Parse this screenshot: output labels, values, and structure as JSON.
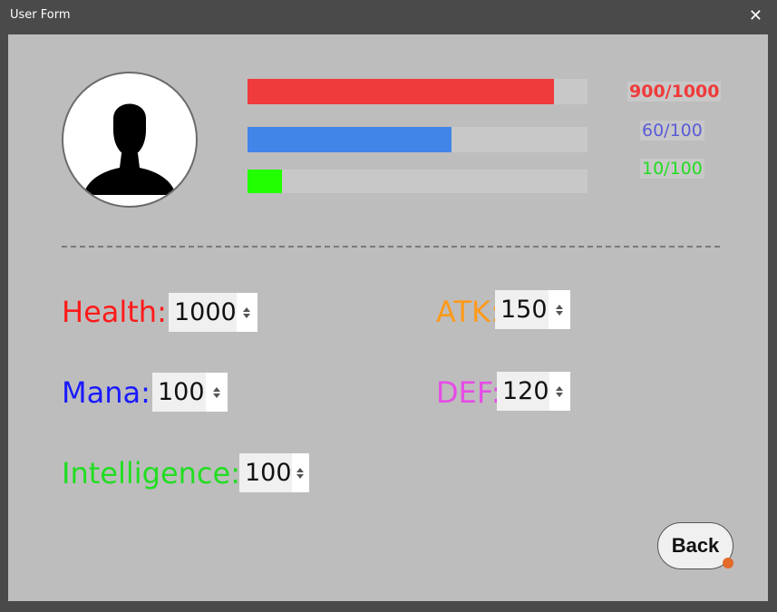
{
  "window": {
    "title": "User Form",
    "close_glyph": "✕"
  },
  "avatar": {
    "icon": "user-silhouette-icon"
  },
  "bars": [
    {
      "name": "health",
      "label": "900/1000",
      "fraction": 0.9,
      "color": "#ef3b3b",
      "label_color": "#ef3b3b"
    },
    {
      "name": "mana",
      "label": "60/100",
      "fraction": 0.6,
      "color": "#4285e8",
      "label_color": "#5b5bd6"
    },
    {
      "name": "intelligence",
      "label": "10/100",
      "fraction": 0.1,
      "color": "#22ff00",
      "label_color": "#22dd22"
    }
  ],
  "fields": {
    "health": {
      "label": "Health:",
      "value": "1000",
      "color": "#ff1a1a"
    },
    "mana": {
      "label": "Mana:",
      "value": "100",
      "color": "#1a1aff"
    },
    "intelligence": {
      "label": "Intelligence:",
      "value": "100",
      "color": "#22dd22"
    },
    "atk": {
      "label": "ATK:",
      "value": "150",
      "color": "#ff9a1a"
    },
    "def": {
      "label": "DEF:",
      "value": "120",
      "color": "#e64ce6"
    }
  },
  "buttons": {
    "back": "Back"
  }
}
